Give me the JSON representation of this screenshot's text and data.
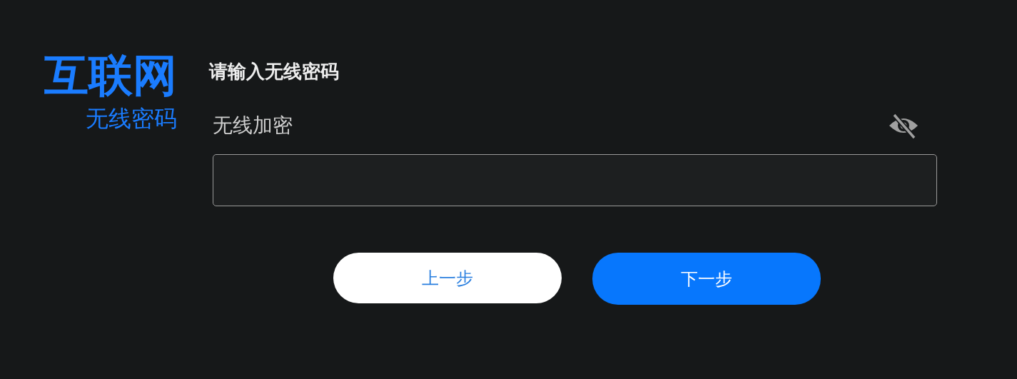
{
  "sidebar": {
    "title": "互联网",
    "subtitle": "无线密码"
  },
  "form": {
    "heading": "请输入无线密码",
    "field_label": "无线加密",
    "password_visible": false
  },
  "buttons": [
    {
      "label": "上一步",
      "kind": "secondary"
    },
    {
      "label": "下一步",
      "kind": "primary"
    }
  ]
}
